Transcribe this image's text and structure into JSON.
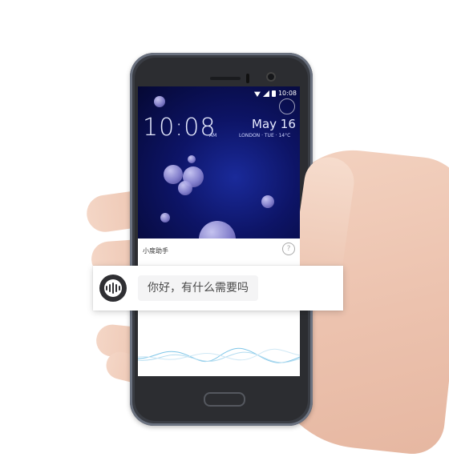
{
  "status_bar": {
    "time": "10:08"
  },
  "lock_screen": {
    "clock": "10:08",
    "am_pm": "AM",
    "date": "May 16",
    "location": "LONDON · TUE · 14°C"
  },
  "assistant": {
    "title": "小度助手",
    "help_glyph": "?",
    "prompt": "你好，有什么需要吗"
  },
  "icons": [
    "wifi-icon",
    "signal-icon",
    "battery-icon",
    "weather-icon",
    "help-icon",
    "voice-assistant-icon"
  ],
  "colors": {
    "wallpaper": "#0d1466",
    "mic": "#2f2f33",
    "wave": "#7fc6e8"
  }
}
